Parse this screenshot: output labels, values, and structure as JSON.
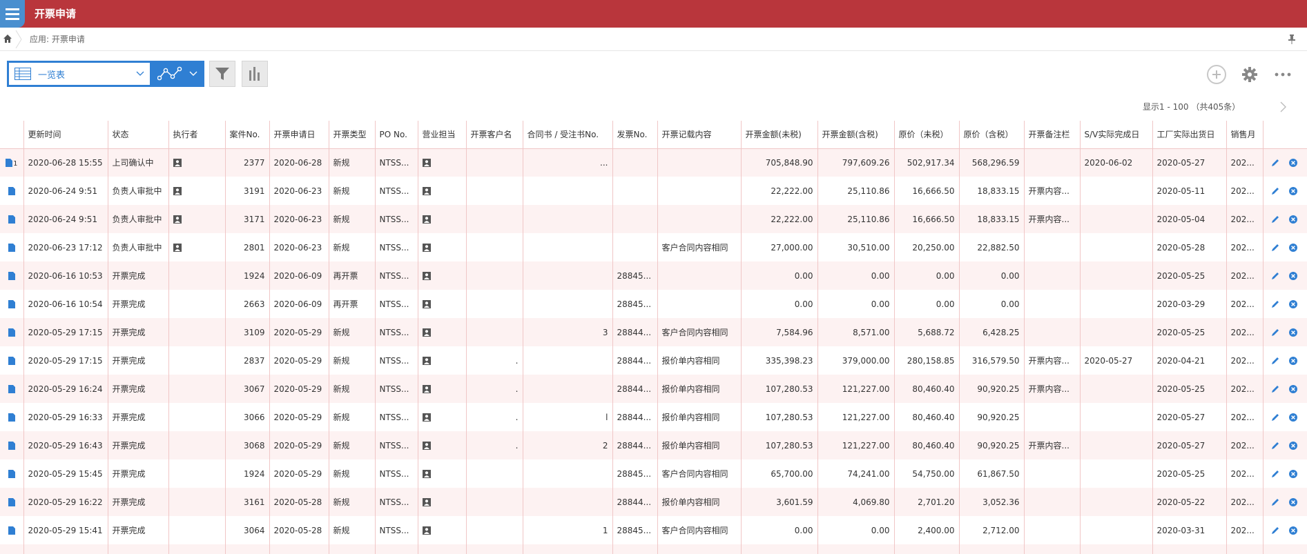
{
  "header": {
    "title": "开票申请"
  },
  "breadcrumb": {
    "path": "应用: 开票申请"
  },
  "toolbar": {
    "view_label": "一览表"
  },
  "pager": {
    "text": "显示1 - 100 （共405条）"
  },
  "columns": [
    "更新时间",
    "状态",
    "执行者",
    "案件No.",
    "开票申请日",
    "开票类型",
    "PO No.",
    "营业担当",
    "开票客户名",
    "合同书 / 受注书No.",
    "发票No.",
    "开票记载内容",
    "开票金额(未税)",
    "开票金额(含税)",
    "原价（未税）",
    "原价（含税）",
    "开票备注栏",
    "S/V实际完成日",
    "工厂实际出货日",
    "销售月"
  ],
  "rows": [
    {
      "badge": "1",
      "updated": "2020-06-28 15:55",
      "status": "上司确认中",
      "exec": true,
      "case": "2377",
      "apply": "2020-06-28",
      "type": "新规",
      "po": "NTSS...",
      "sales": true,
      "customer": "",
      "contract": "...",
      "invoice": "",
      "content": "",
      "amt_ex": "705,848.90",
      "amt_in": "797,609.26",
      "cost_ex": "502,917.34",
      "cost_in": "568,296.59",
      "remark": "",
      "sv": "2020-06-02",
      "ship": "2020-05-27",
      "month": "202..."
    },
    {
      "badge": "",
      "updated": "2020-06-24 9:51",
      "status": "负责人审批中",
      "exec": true,
      "case": "3191",
      "apply": "2020-06-23",
      "type": "新规",
      "po": "NTSS...",
      "sales": true,
      "customer": "",
      "contract": "",
      "invoice": "",
      "content": "",
      "amt_ex": "22,222.00",
      "amt_in": "25,110.86",
      "cost_ex": "16,666.50",
      "cost_in": "18,833.15",
      "remark": "开票内容...",
      "sv": "",
      "ship": "2020-05-11",
      "month": "202..."
    },
    {
      "badge": "",
      "updated": "2020-06-24 9:51",
      "status": "负责人审批中",
      "exec": true,
      "case": "3171",
      "apply": "2020-06-23",
      "type": "新规",
      "po": "NTSS...",
      "sales": true,
      "customer": "",
      "contract": "",
      "invoice": "",
      "content": "",
      "amt_ex": "22,222.00",
      "amt_in": "25,110.86",
      "cost_ex": "16,666.50",
      "cost_in": "18,833.15",
      "remark": "开票内容...",
      "sv": "",
      "ship": "2020-05-04",
      "month": "202..."
    },
    {
      "badge": "",
      "updated": "2020-06-23 17:12",
      "status": "负责人审批中",
      "exec": true,
      "case": "2801",
      "apply": "2020-06-23",
      "type": "新规",
      "po": "NTSS...",
      "sales": true,
      "customer": "",
      "contract": "",
      "invoice": "",
      "content": "客户合同内容相同",
      "amt_ex": "27,000.00",
      "amt_in": "30,510.00",
      "cost_ex": "20,250.00",
      "cost_in": "22,882.50",
      "remark": "",
      "sv": "",
      "ship": "2020-05-28",
      "month": "202..."
    },
    {
      "badge": "",
      "updated": "2020-06-16 10:53",
      "status": "开票完成",
      "exec": false,
      "case": "1924",
      "apply": "2020-06-09",
      "type": "再开票",
      "po": "NTSS...",
      "sales": true,
      "customer": "",
      "contract": "",
      "invoice": "28845...",
      "content": "",
      "amt_ex": "0.00",
      "amt_in": "0.00",
      "cost_ex": "0.00",
      "cost_in": "0.00",
      "remark": "",
      "sv": "",
      "ship": "2020-05-25",
      "month": "202..."
    },
    {
      "badge": "",
      "updated": "2020-06-16 10:54",
      "status": "开票完成",
      "exec": false,
      "case": "2663",
      "apply": "2020-06-09",
      "type": "再开票",
      "po": "NTSS...",
      "sales": true,
      "customer": "",
      "contract": "",
      "invoice": "28845...",
      "content": "",
      "amt_ex": "0.00",
      "amt_in": "0.00",
      "cost_ex": "0.00",
      "cost_in": "0.00",
      "remark": "",
      "sv": "",
      "ship": "2020-03-29",
      "month": "202..."
    },
    {
      "badge": "",
      "updated": "2020-05-29 17:15",
      "status": "开票完成",
      "exec": false,
      "case": "3109",
      "apply": "2020-05-29",
      "type": "新规",
      "po": "NTSS...",
      "sales": true,
      "customer": "",
      "contract": "3",
      "invoice": "28844...",
      "content": "客户合同内容相同",
      "amt_ex": "7,584.96",
      "amt_in": "8,571.00",
      "cost_ex": "5,688.72",
      "cost_in": "6,428.25",
      "remark": "",
      "sv": "",
      "ship": "2020-05-25",
      "month": "202..."
    },
    {
      "badge": "",
      "updated": "2020-05-29 17:15",
      "status": "开票完成",
      "exec": false,
      "case": "2837",
      "apply": "2020-05-29",
      "type": "新规",
      "po": "NTSS...",
      "sales": true,
      "customer": ".",
      "contract": "",
      "invoice": "28844...",
      "content": "报价单内容相同",
      "amt_ex": "335,398.23",
      "amt_in": "379,000.00",
      "cost_ex": "280,158.85",
      "cost_in": "316,579.50",
      "remark": "开票内容...",
      "sv": "2020-05-27",
      "ship": "2020-04-21",
      "month": "202..."
    },
    {
      "badge": "",
      "updated": "2020-05-29 16:24",
      "status": "开票完成",
      "exec": false,
      "case": "3067",
      "apply": "2020-05-29",
      "type": "新规",
      "po": "NTSS...",
      "sales": true,
      "customer": ".",
      "contract": "",
      "invoice": "28844...",
      "content": "报价单内容相同",
      "amt_ex": "107,280.53",
      "amt_in": "121,227.00",
      "cost_ex": "80,460.40",
      "cost_in": "90,920.25",
      "remark": "开票内容...",
      "sv": "",
      "ship": "2020-05-25",
      "month": "202..."
    },
    {
      "badge": "",
      "updated": "2020-05-29 16:33",
      "status": "开票完成",
      "exec": false,
      "case": "3066",
      "apply": "2020-05-29",
      "type": "新规",
      "po": "NTSS...",
      "sales": true,
      "customer": ".",
      "contract": "l",
      "invoice": "28844...",
      "content": "报价单内容相同",
      "amt_ex": "107,280.53",
      "amt_in": "121,227.00",
      "cost_ex": "80,460.40",
      "cost_in": "90,920.25",
      "remark": "",
      "sv": "",
      "ship": "2020-05-27",
      "month": "202..."
    },
    {
      "badge": "",
      "updated": "2020-05-29 16:43",
      "status": "开票完成",
      "exec": false,
      "case": "3068",
      "apply": "2020-05-29",
      "type": "新规",
      "po": "NTSS...",
      "sales": true,
      "customer": ".",
      "contract": "2",
      "invoice": "28844...",
      "content": "报价单内容相同",
      "amt_ex": "107,280.53",
      "amt_in": "121,227.00",
      "cost_ex": "80,460.40",
      "cost_in": "90,920.25",
      "remark": "开票内容...",
      "sv": "",
      "ship": "2020-05-27",
      "month": "202..."
    },
    {
      "badge": "",
      "updated": "2020-05-29 15:45",
      "status": "开票完成",
      "exec": false,
      "case": "1924",
      "apply": "2020-05-29",
      "type": "新规",
      "po": "NTSS...",
      "sales": true,
      "customer": "",
      "contract": "",
      "invoice": "28845...",
      "content": "客户合同内容相同",
      "amt_ex": "65,700.00",
      "amt_in": "74,241.00",
      "cost_ex": "54,750.00",
      "cost_in": "61,867.50",
      "remark": "",
      "sv": "",
      "ship": "2020-05-25",
      "month": "202..."
    },
    {
      "badge": "",
      "updated": "2020-05-29 16:22",
      "status": "开票完成",
      "exec": false,
      "case": "3161",
      "apply": "2020-05-28",
      "type": "新规",
      "po": "NTSS...",
      "sales": true,
      "customer": "",
      "contract": "",
      "invoice": "28844...",
      "content": "报价单内容相同",
      "amt_ex": "3,601.59",
      "amt_in": "4,069.80",
      "cost_ex": "2,701.20",
      "cost_in": "3,052.36",
      "remark": "",
      "sv": "",
      "ship": "2020-05-22",
      "month": "202..."
    },
    {
      "badge": "",
      "updated": "2020-05-29 15:41",
      "status": "开票完成",
      "exec": false,
      "case": "3064",
      "apply": "2020-05-28",
      "type": "新规",
      "po": "NTSS...",
      "sales": true,
      "customer": "",
      "contract": "1",
      "invoice": "28845...",
      "content": "客户合同内容相同",
      "amt_ex": "0.00",
      "amt_in": "0.00",
      "cost_ex": "2,400.00",
      "cost_in": "2,712.00",
      "remark": "",
      "sv": "",
      "ship": "2020-03-31",
      "month": "202..."
    },
    {
      "badge": "",
      "updated": "",
      "status": "",
      "exec": false,
      "case": "",
      "apply": "",
      "type": "",
      "po": "",
      "sales": false,
      "customer": "",
      "contract": "",
      "invoice": "",
      "content": "",
      "amt_ex": "",
      "amt_in": "",
      "cost_ex": "",
      "cost_in": "",
      "remark": "",
      "sv": "",
      "ship": "",
      "month": ""
    }
  ],
  "colors": {
    "header_bg": "#b9363c",
    "accent": "#2f7fd3",
    "row_alt": "#fdf2f2",
    "grid_line": "#f0c6c6"
  },
  "icons": [
    "menu-icon",
    "home-icon",
    "pin-icon",
    "table-icon",
    "chevron-down-icon",
    "graph-icon",
    "filter-icon",
    "bar-chart-icon",
    "plus-icon",
    "gear-icon",
    "more-icon",
    "chevron-right-icon",
    "document-icon",
    "user-icon",
    "edit-icon",
    "delete-icon"
  ]
}
